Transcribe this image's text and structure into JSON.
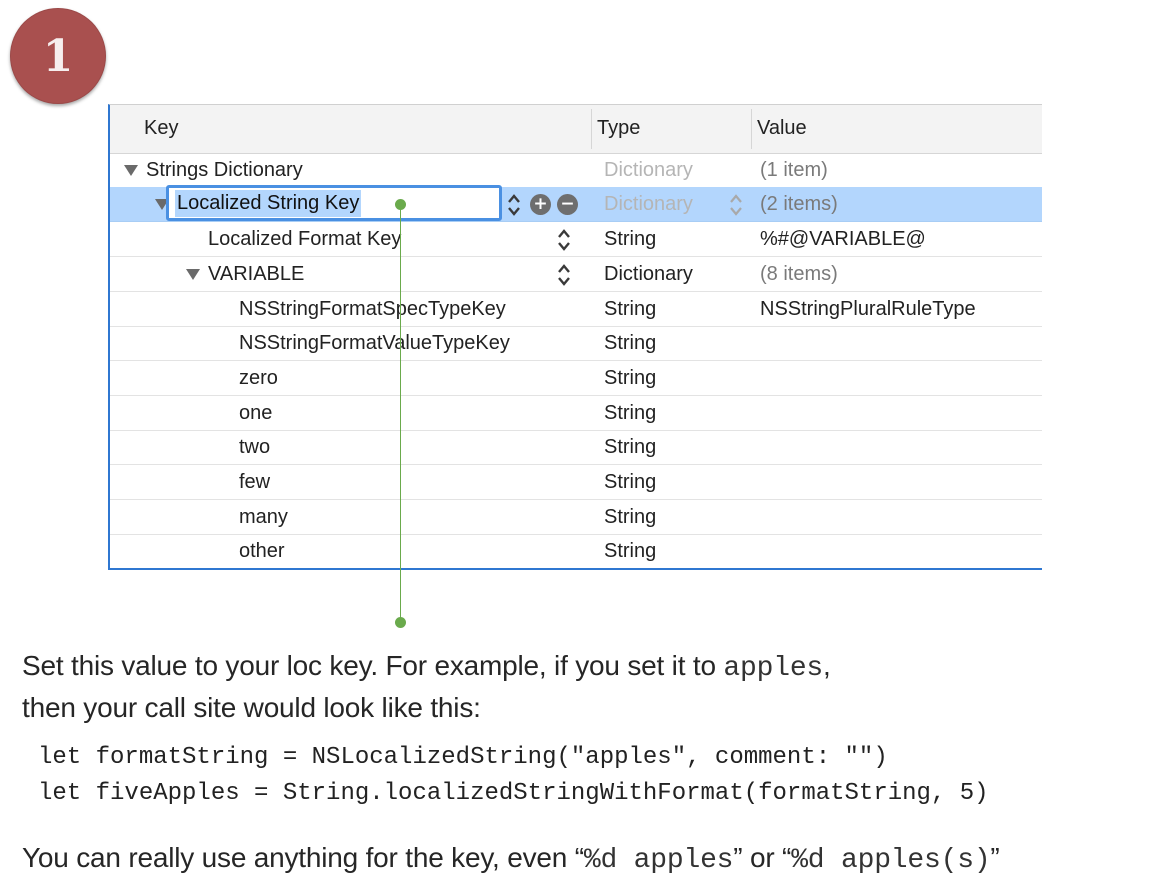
{
  "step_badge": "1",
  "plist": {
    "headers": {
      "key": "Key",
      "type": "Type",
      "value": "Value"
    },
    "rows": [
      {
        "key": "Strings Dictionary",
        "type": "Dictionary",
        "value": "(1 item)"
      },
      {
        "key": "Localized String Key",
        "type": "Dictionary",
        "value": "(2 items)"
      },
      {
        "key": "Localized Format Key",
        "type": "String",
        "value": "%#@VARIABLE@"
      },
      {
        "key": "VARIABLE",
        "type": "Dictionary",
        "value": "(8 items)"
      },
      {
        "key": "NSStringFormatSpecTypeKey",
        "type": "String",
        "value": "NSStringPluralRuleType"
      },
      {
        "key": "NSStringFormatValueTypeKey",
        "type": "String",
        "value": ""
      },
      {
        "key": "zero",
        "type": "String",
        "value": ""
      },
      {
        "key": "one",
        "type": "String",
        "value": ""
      },
      {
        "key": "two",
        "type": "String",
        "value": ""
      },
      {
        "key": "few",
        "type": "String",
        "value": ""
      },
      {
        "key": "many",
        "type": "String",
        "value": ""
      },
      {
        "key": "other",
        "type": "String",
        "value": ""
      }
    ],
    "add_glyph": "+",
    "remove_glyph": "−"
  },
  "callout": {
    "line1_a": "Set this value to your loc key.  For example, if you set it to ",
    "line1_code": "apples",
    "line1_b": ",",
    "line2": "then your call site would look like this:"
  },
  "code_lines": [
    "let formatString = NSLocalizedString(\"apples\", comment: \"\")",
    "let fiveApples = String.localizedStringWithFormat(formatString, 5)"
  ],
  "footer": {
    "text_a": "You can really use anything for the key, even “",
    "code1": "%d apples",
    "text_b": "” or “",
    "code2": "%d apples(s)",
    "text_c": "”"
  },
  "colors": {
    "badge": "#a9504f",
    "selection": "#b3d6fd",
    "focus": "#4a90e2",
    "callout": "#6aaa4c"
  }
}
